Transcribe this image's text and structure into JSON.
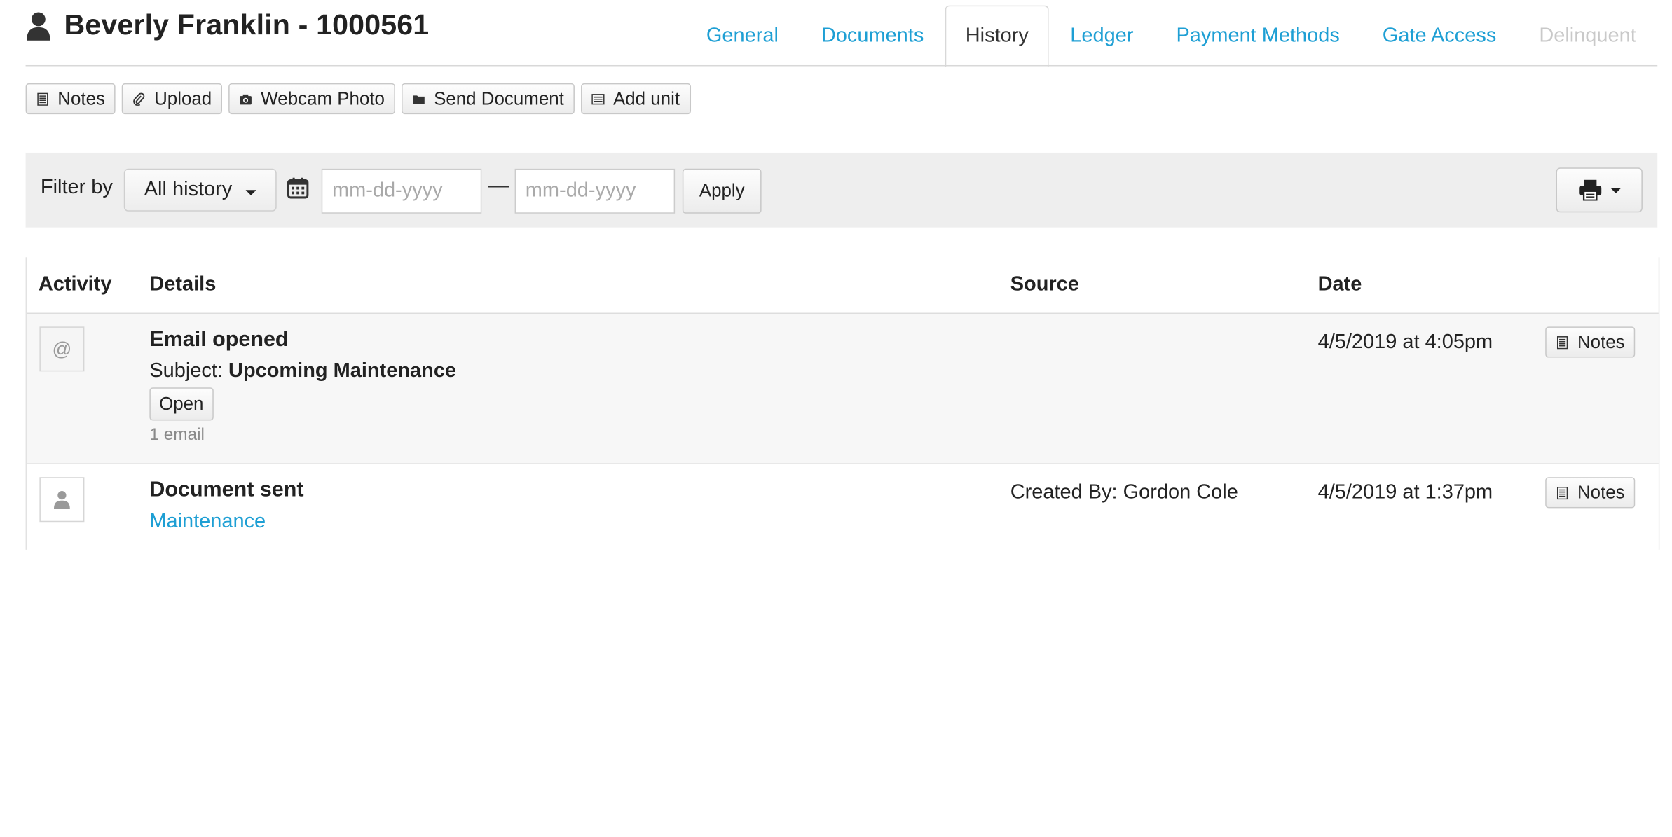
{
  "header": {
    "customer_name": "Beverly Franklin - 1000561",
    "tabs": [
      "General",
      "Documents",
      "History",
      "Ledger",
      "Payment Methods",
      "Gate Access",
      "Delinquent"
    ],
    "active_tab": "History",
    "disabled_tab": "Delinquent"
  },
  "toolbar": {
    "notes": "Notes",
    "upload": "Upload",
    "webcam_photo": "Webcam Photo",
    "send_document": "Send Document",
    "add_unit": "Add unit"
  },
  "filter": {
    "label": "Filter by",
    "selected": "All history",
    "start_placeholder": "mm-dd-yyyy",
    "dash": "—",
    "end_placeholder": "mm-dd-yyyy",
    "apply": "Apply"
  },
  "table": {
    "columns": [
      "Activity",
      "Details",
      "Source",
      "Date"
    ],
    "rows": [
      {
        "icon": "at-sign-icon",
        "title": "Email opened",
        "subject_label": "Subject:",
        "subject_value": "Upcoming Maintenance",
        "action": "Open",
        "count": "1 email",
        "source": "",
        "date": "4/5/2019 at 4:05pm",
        "notes": "Notes"
      },
      {
        "icon": "person-icon",
        "title": "Document sent",
        "link": "Maintenance",
        "source": "Created By: Gordon Cole",
        "date": "4/5/2019 at 1:37pm",
        "notes": "Notes"
      }
    ]
  },
  "colors": {
    "link_blue": "#1e9fd4",
    "filter_bg": "#eeeeee",
    "disabled_tab": "#c9c9c9"
  }
}
